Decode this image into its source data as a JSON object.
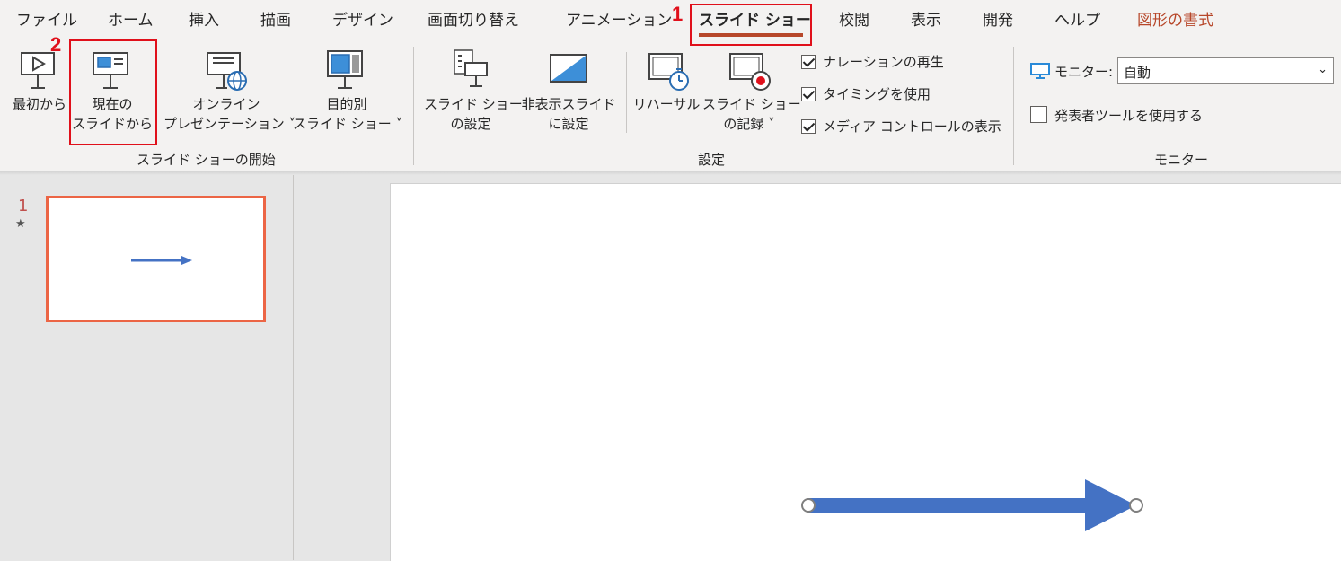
{
  "tabs": [
    {
      "label": "ファイル"
    },
    {
      "label": "ホーム"
    },
    {
      "label": "挿入"
    },
    {
      "label": "描画"
    },
    {
      "label": "デザイン"
    },
    {
      "label": "画面切り替え"
    },
    {
      "label": "アニメーション"
    },
    {
      "label": "スライド ショー"
    },
    {
      "label": "校閲"
    },
    {
      "label": "表示"
    },
    {
      "label": "開発"
    },
    {
      "label": "ヘルプ"
    },
    {
      "label": "図形の書式"
    }
  ],
  "annotations": {
    "marker1": "1",
    "marker2": "2"
  },
  "ribbon": {
    "start_group": {
      "label": "スライド ショーの開始",
      "from_beginning": "最初から",
      "from_current_1": "現在の",
      "from_current_2": "スライドから",
      "online_1": "オンライン",
      "online_2": "プレゼンテーション ˅",
      "custom_1": "目的別",
      "custom_2": "スライド ショー ˅"
    },
    "setup_group": {
      "label": "設定",
      "setup_1": "スライド ショー",
      "setup_2": "の設定",
      "hide_1": "非表示スライド",
      "hide_2": "に設定",
      "rehearse": "リハーサル",
      "record_1": "スライド ショー",
      "record_2": "の記録 ˅",
      "narration": "ナレーションの再生",
      "timings": "タイミングを使用",
      "media": "メディア コントロールの表示"
    },
    "monitor_group": {
      "label": "モニター",
      "monitor_label": "モニター:",
      "monitor_value": "自動",
      "presenter_view": "発表者ツールを使用する"
    }
  },
  "checkbox_states": {
    "narration": true,
    "timings": true,
    "media": true,
    "presenter_view": false
  },
  "thumbnails": [
    {
      "number": "1",
      "indicator": "★"
    }
  ],
  "colors": {
    "accent": "#b7472a",
    "selection": "#ec6545",
    "arrow": "#4472c4",
    "annotation": "#e0101b"
  }
}
